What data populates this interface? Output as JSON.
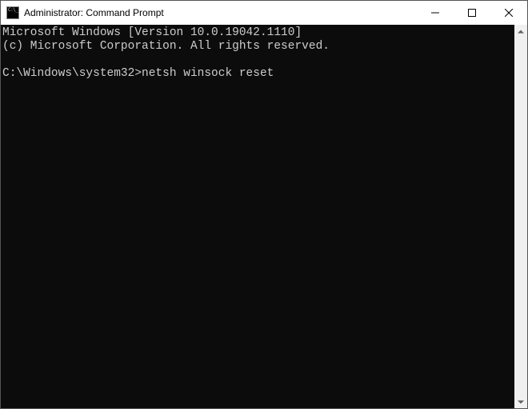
{
  "window": {
    "title": "Administrator: Command Prompt"
  },
  "console": {
    "line1": "Microsoft Windows [Version 10.0.19042.1110]",
    "line2": "(c) Microsoft Corporation. All rights reserved.",
    "prompt": "C:\\Windows\\system32>",
    "command": "netsh winsock reset"
  }
}
